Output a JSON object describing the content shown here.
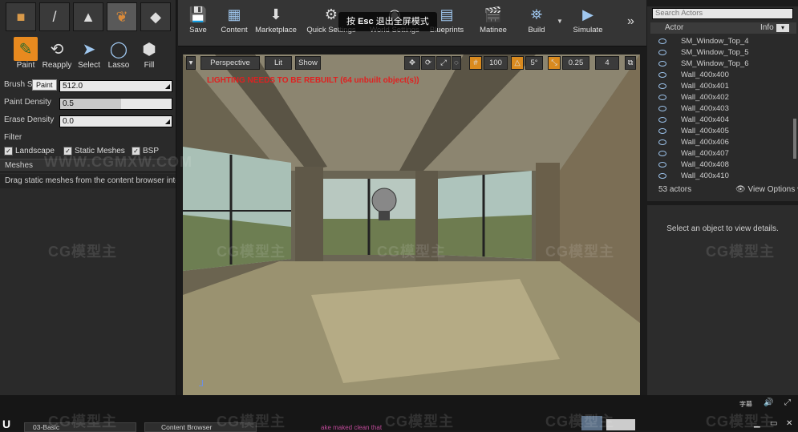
{
  "modes": [
    "place-mode",
    "paint-mode",
    "landscape-mode",
    "foliage-mode",
    "geometry-mode"
  ],
  "tools": {
    "paint": "Paint",
    "reapply": "Reapply",
    "select": "Select",
    "lasso": "Lasso",
    "fill": "Fill",
    "tooltip": "Paint"
  },
  "props": {
    "brush_size_label": "Brush S",
    "brush_size_value": "512.0",
    "paint_density_label": "Paint Density",
    "paint_density_value": "0.5",
    "paint_density_fraction": 0.55,
    "erase_density_label": "Erase Density",
    "erase_density_value": "0.0",
    "filter_label": "Filter",
    "landscape": "Landscape",
    "static_meshes": "Static Meshes",
    "bsp": "BSP",
    "meshes_header": "Meshes",
    "hint": "Drag static meshes from the content browser into"
  },
  "toolbar": {
    "save": "Save",
    "content": "Content",
    "marketplace": "Marketplace",
    "quick_settings": "Quick Settings",
    "world_settings": "World Settings",
    "blueprints": "Blueprints",
    "matinee": "Matinee",
    "build": "Build",
    "simulate": "Simulate",
    "esc_pre": "按",
    "esc_key": "Esc",
    "esc_post": "退出全屏模式"
  },
  "viewport": {
    "perspective": "Perspective",
    "lit": "Lit",
    "show": "Show",
    "grid": "100",
    "rot": "5°",
    "scale": "0.25",
    "cam": "4",
    "warning": "LIGHTING NEEDS TO BE REBUILT (64 unbuilt object(s))"
  },
  "outliner": {
    "search_placeholder": "Search Actors",
    "col_actor": "Actor",
    "col_info": "Info",
    "actors": [
      "SM_Window_Top_4",
      "SM_Window_Top_5",
      "SM_Window_Top_6",
      "Wall_400x400",
      "Wall_400x401",
      "Wall_400x402",
      "Wall_400x403",
      "Wall_400x404",
      "Wall_400x405",
      "Wall_400x406",
      "Wall_400x407",
      "Wall_400x408",
      "Wall_400x410"
    ],
    "count": "53 actors",
    "view_options": "View Options"
  },
  "details": {
    "empty": "Select an object to view details."
  },
  "taskbar": {
    "ime": "字幕",
    "tab1": "03-Basic",
    "tab2": "Content Browser",
    "text": "ake maked  clean that"
  },
  "watermark": {
    "logo": "CG模型主",
    "url": "WWW.CGMXW.COM"
  }
}
